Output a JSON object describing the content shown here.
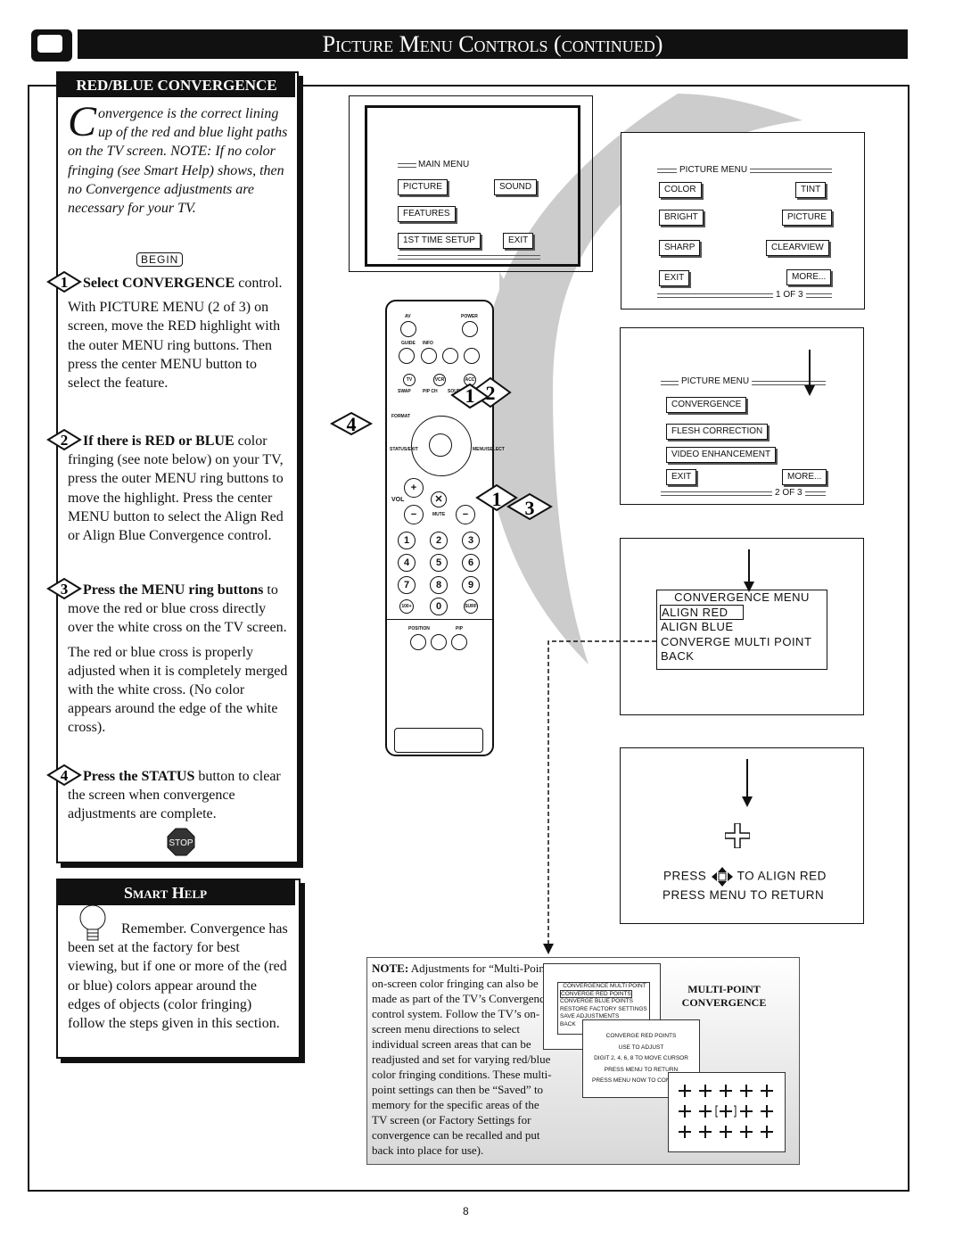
{
  "header": {
    "title": "Picture Menu Controls (continued)"
  },
  "left_panel": {
    "heading": "RED/BLUE CONVERGENCE",
    "intro_dropcap": "C",
    "intro": "onvergence is the correct lining up of the red and blue light paths on the TV screen. NOTE: If no color fringing (see Smart Help) shows, then no Convergence adjustments are necessary for your TV.",
    "begin": "BEGIN",
    "steps": [
      {
        "num": "1",
        "bold": "Select CONVERGENCE",
        "text": " control.",
        "text2": "With PICTURE MENU (2 of 3) on screen, move the RED highlight with the outer MENU ring buttons. Then press the center MENU button to select the feature."
      },
      {
        "num": "2",
        "bold": "If there is RED or BLUE",
        "text": " color fringing (see note below) on your TV, press the outer MENU ring buttons to move the highlight. Press the center MENU button to select the Align Red or Align Blue Convergence control."
      },
      {
        "num": "3",
        "bold": "Press the MENU ring buttons",
        "text": " to move the red or blue cross directly over the white cross on the TV screen.",
        "text2": "The red or blue cross is properly adjusted when it is completely merged with the white cross. (No color appears around the edge of the white cross)."
      },
      {
        "num": "4",
        "bold": "Press the STATUS",
        "text": " button to clear the screen when convergence adjustments are complete."
      }
    ],
    "stop": "STOP"
  },
  "smart_help": {
    "heading": "Smart Help",
    "text": "Remember. Convergence has been set at the factory for best viewing, but if one or more of the (red or blue) colors appear around the edges of objects (color fringing) follow the steps given in this section."
  },
  "main_menu": {
    "title": "MAIN MENU",
    "items": [
      "PICTURE",
      "SOUND",
      "FEATURES",
      "1ST TIME SETUP",
      "EXIT"
    ]
  },
  "picture_menu_1": {
    "title": "PICTURE MENU",
    "items": [
      "COLOR",
      "TINT",
      "BRIGHT",
      "PICTURE",
      "SHARP",
      "CLEARVIEW",
      "EXIT",
      "MORE..."
    ],
    "page": "1 OF 3"
  },
  "picture_menu_2": {
    "title": "PICTURE MENU",
    "items": [
      "CONVERGENCE",
      "FLESH CORRECTION",
      "VIDEO ENHANCEMENT",
      "EXIT",
      "MORE..."
    ],
    "page": "2 OF 3"
  },
  "convergence_menu": {
    "title": "CONVERGENCE MENU",
    "items": [
      "ALIGN RED",
      "ALIGN BLUE",
      "CONVERGE MULTI POINT",
      "BACK"
    ],
    "selected": "ALIGN RED"
  },
  "align_screen": {
    "line1a": "PRESS",
    "line1b": "TO ALIGN RED",
    "line2": "PRESS MENU TO RETURN"
  },
  "remote": {
    "labels": [
      "AV",
      "POWER",
      "GUIDE",
      "INFO",
      "TV",
      "VCR",
      "ACC",
      "SWAP",
      "PIP CH",
      "DN",
      "UP",
      "SOURCE",
      "FREEZE",
      "FORMAT",
      "STATUS/EXIT",
      "MENU/SELECT",
      "VOL",
      "MUTE",
      "1",
      "2",
      "3",
      "4",
      "5",
      "6",
      "7",
      "8",
      "9",
      "100+",
      "0",
      "SURF",
      "POSITION",
      "PIP"
    ],
    "callouts": [
      "1",
      "2",
      "4",
      "1",
      "3"
    ]
  },
  "note": {
    "label": "NOTE:",
    "text": " Adjustments for “Multi-Point” on-screen color fringing can also be made as part of the TV’s Convergence control system. Follow the TV’s on-screen menu directions to select individual screen areas that can be readjusted and set for varying red/blue color fringing conditions. These multi-point settings can then be “Saved” to memory for the specific areas of the TV screen (or Factory Settings for convergence can be recalled and put back into place for use).",
    "title": "MULTI-POINT CONVERGENCE",
    "mp_menu": {
      "title": "CONVERGENCE MULTI POINT",
      "items": [
        "CONVERGE RED POINTS",
        "CONVERGE BLUE POINTS",
        "RESTORE FACTORY SETTINGS",
        "SAVE ADJUSTMENTS",
        "BACK"
      ]
    },
    "mp_red": {
      "lines": [
        "CONVERGE RED POINTS",
        "USE   TO ADJUST",
        "DIGIT 2, 4, 6, 8 TO MOVE CURSOR",
        "PRESS MENU TO RETURN",
        "PRESS MENU NOW TO CON"
      ]
    }
  },
  "page_number": "8"
}
